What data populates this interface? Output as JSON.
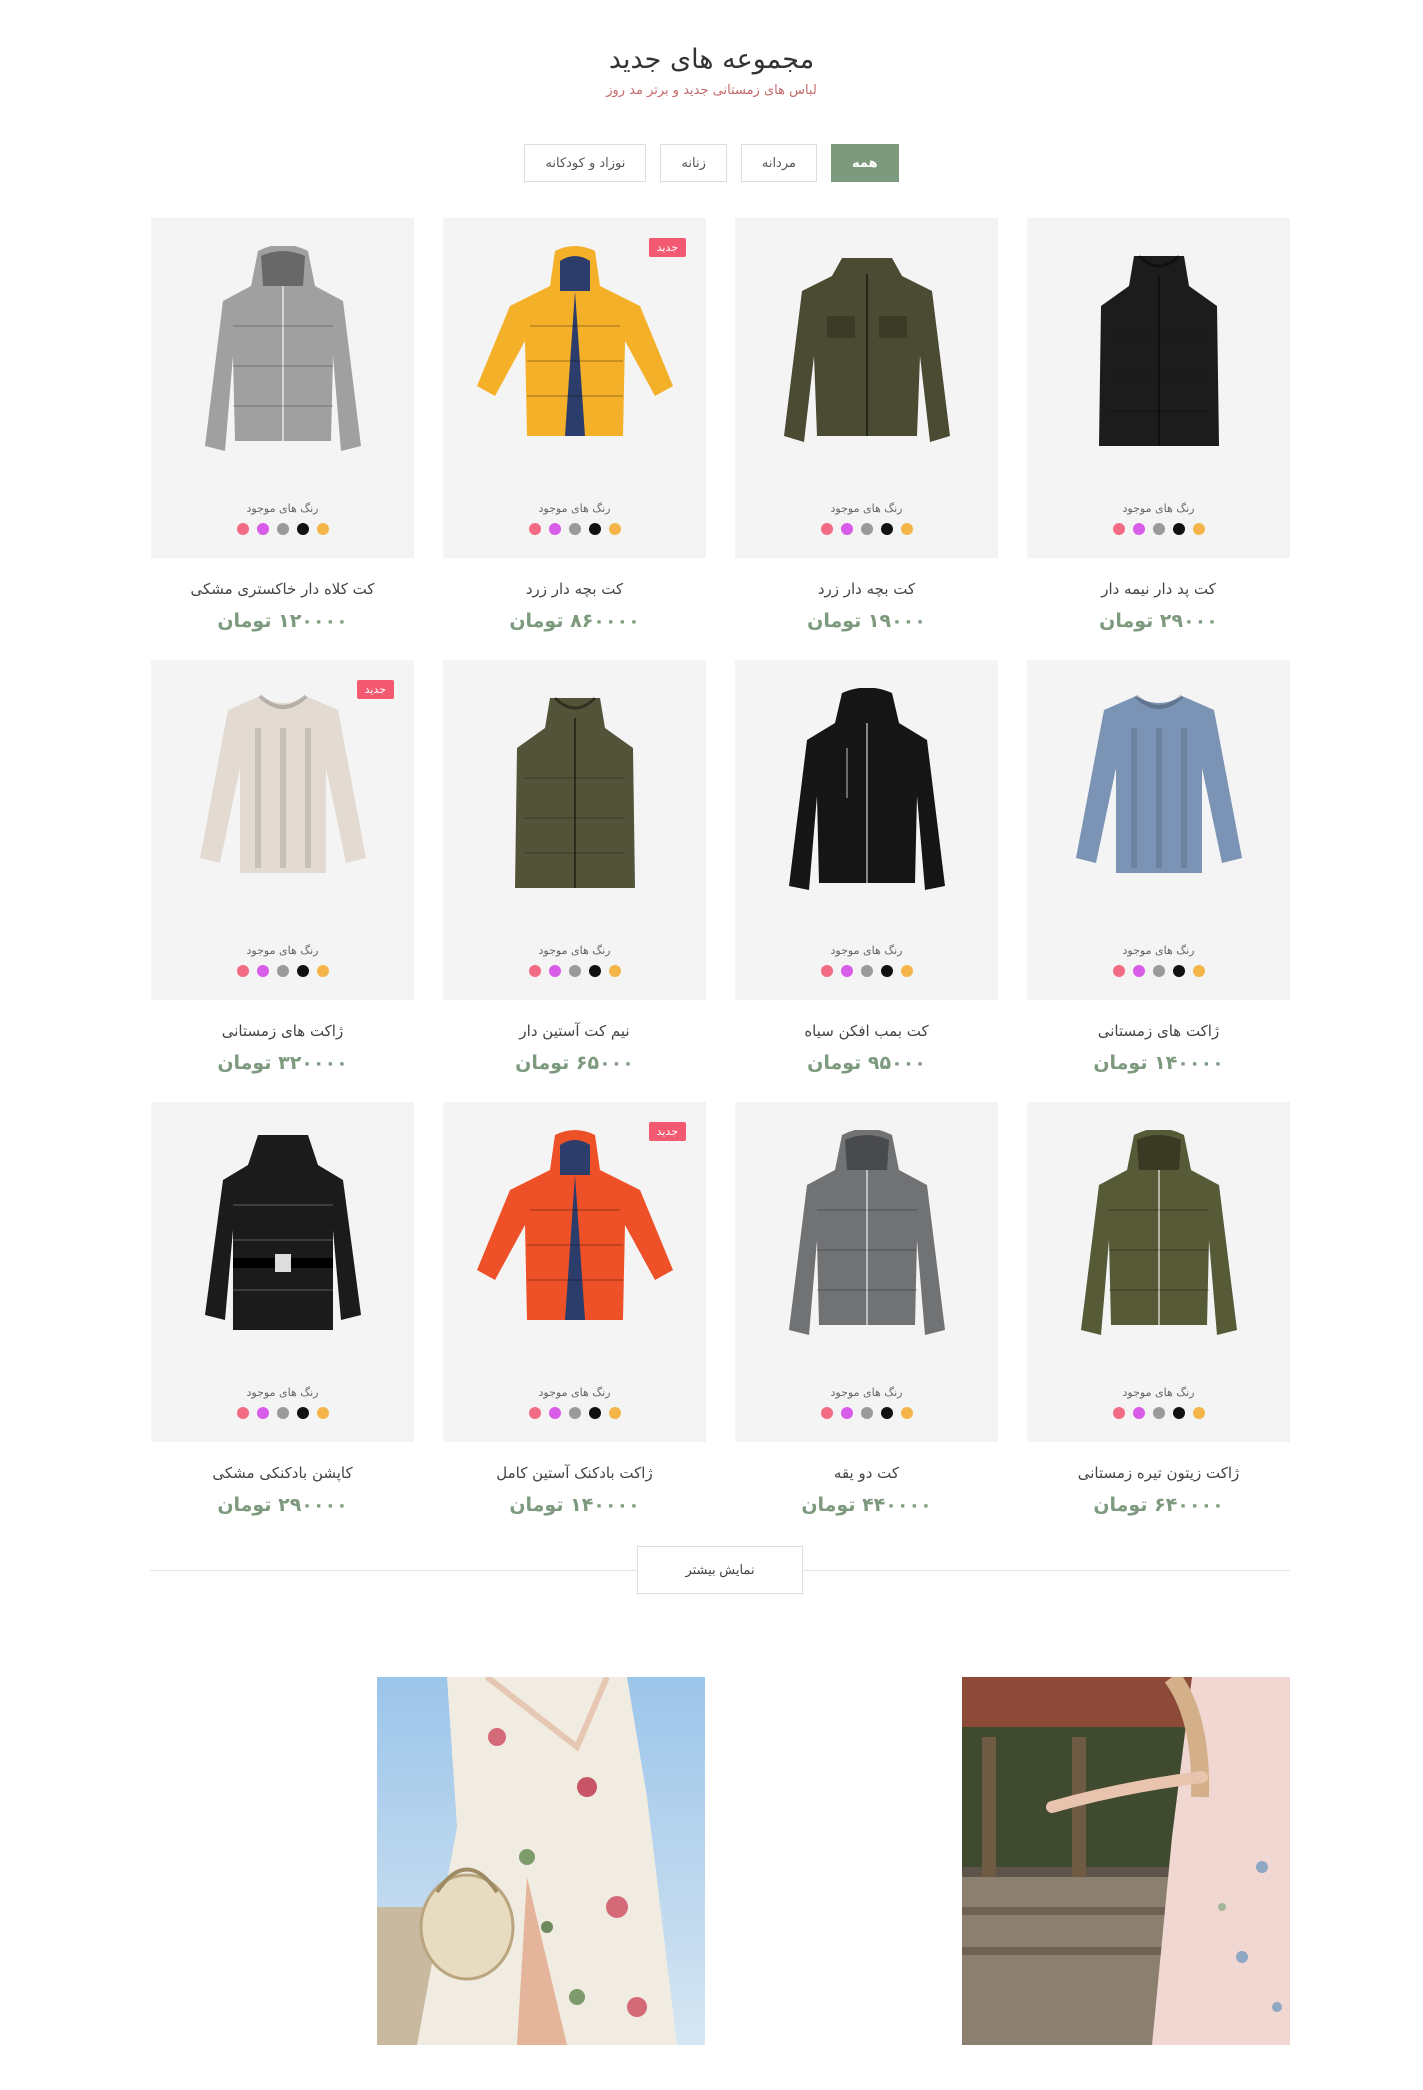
{
  "header": {
    "title": "مجموعه های جدید",
    "subtitle": "لباس های زمستانی جدید و برتر مد روز"
  },
  "filters": [
    {
      "label": "همه",
      "active": true
    },
    {
      "label": "مردانه",
      "active": false
    },
    {
      "label": "زنانه",
      "active": false
    },
    {
      "label": "نوزاد و کودکانه",
      "active": false
    }
  ],
  "colors_label": "رنگ های موجود",
  "badge_label": "جدید",
  "swatch_colors": [
    "#f36b83",
    "#d95ce8",
    "#9a9a9a",
    "#111111",
    "#f3b54a"
  ],
  "products": [
    {
      "name": "کت پد دار نیمه دار",
      "price": "۲۹۰۰۰ تومان",
      "icon": "vest-icon",
      "color": "#1c1c1c",
      "is_new": false
    },
    {
      "name": "کت بچه دار زرد",
      "price": "۱۹۰۰۰ تومان",
      "icon": "field-jacket-icon",
      "color": "#4b4a33",
      "is_new": false
    },
    {
      "name": "کت بچه دار زرد",
      "price": "۸۶۰۰۰۰ تومان",
      "icon": "puffer-jacket-icon",
      "color": "#f5b02a",
      "is_new": true
    },
    {
      "name": "کت کلاه دار خاکستری مشکی",
      "price": "۱۲۰۰۰۰ تومان",
      "icon": "hooded-jacket-icon",
      "color": "#a0a0a0",
      "is_new": false
    },
    {
      "name": "ژاکت های زمستانی",
      "price": "۱۴۰۰۰۰ تومان",
      "icon": "sweater-icon",
      "color": "#7b93b4",
      "is_new": false
    },
    {
      "name": "کت بمب افکن سیاه",
      "price": "۹۵۰۰۰ تومان",
      "icon": "softshell-jacket-icon",
      "color": "#151515",
      "is_new": false
    },
    {
      "name": "نیم کت آستین دار",
      "price": "۶۵۰۰۰ تومان",
      "icon": "vest-icon",
      "color": "#53533a",
      "is_new": false
    },
    {
      "name": "ژاکت های زمستانی",
      "price": "۳۲۰۰۰۰ تومان",
      "icon": "sweater-icon",
      "color": "#e3dbd2",
      "is_new": true
    },
    {
      "name": "ژاکت زیتون تیره زمستانی",
      "price": "۶۴۰۰۰۰ تومان",
      "icon": "hooded-jacket-icon",
      "color": "#575a36",
      "is_new": false
    },
    {
      "name": "کت دو یقه",
      "price": "۴۴۰۰۰۰ تومان",
      "icon": "hooded-jacket-icon",
      "color": "#707274",
      "is_new": false
    },
    {
      "name": "ژاکت بادکنک آستین کامل",
      "price": "۱۴۰۰۰۰ تومان",
      "icon": "puffer-jacket-icon",
      "color": "#ee5128",
      "is_new": true
    },
    {
      "name": "کاپشن بادکنکی مشکی",
      "price": "۲۹۰۰۰۰ تومان",
      "icon": "puffer-coat-icon",
      "color": "#1b1b1b",
      "is_new": false
    }
  ],
  "load_more_label": "نمایش بیشتر"
}
